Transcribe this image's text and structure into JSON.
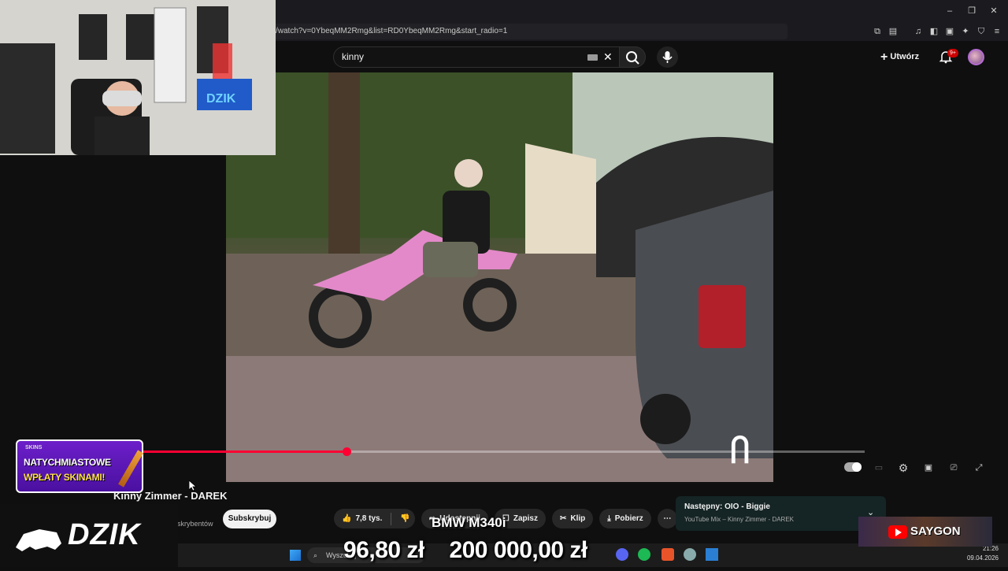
{
  "browser": {
    "url": "/watch?v=0YbeqMM2Rmg&list=RD0YbeqMM2Rmg&start_radio=1",
    "window_controls": [
      "minimize-icon",
      "restore-icon",
      "close-icon"
    ]
  },
  "header": {
    "search_value": "kinny",
    "create_label": "Utwórz",
    "notifications_badge": "9+"
  },
  "video": {
    "title": "Kinny Zimmer - DAREK",
    "progress_fraction": 0.39,
    "subscribers_fragment": "skrybentów",
    "subscribe_label": "Subskrybuj",
    "actions": {
      "like_count": "7,8 tys.",
      "share_label": "Udostępnij",
      "save_label": "Zapisz",
      "clip_label": "Klip",
      "download_label": "Pobierz"
    }
  },
  "up_next": {
    "heading": "Następny: OIO - Biggie",
    "subtitle": "YouTube Mix – Kinny Zimmer - DAREK"
  },
  "overlays": {
    "promo_brand": "SKINS",
    "promo_line1": "NATYCHMIASTOWE",
    "promo_line2": "WPŁATY SKINAMI!",
    "dzik_logo": "DZIK",
    "webcam_sign": "DZIK",
    "car_label": "BMW M340i",
    "price_current": "96,80 zł",
    "price_goal": "200 000,00 zł",
    "channel_badge": "SAYGON"
  },
  "taskbar": {
    "search_placeholder": "Wyszukaj",
    "time": "21:26",
    "date": "09.04.2026"
  },
  "colors": {
    "accent_red": "#ff0033",
    "promo_purple": "#6c1fc9",
    "up_next_bg": "#152424"
  }
}
